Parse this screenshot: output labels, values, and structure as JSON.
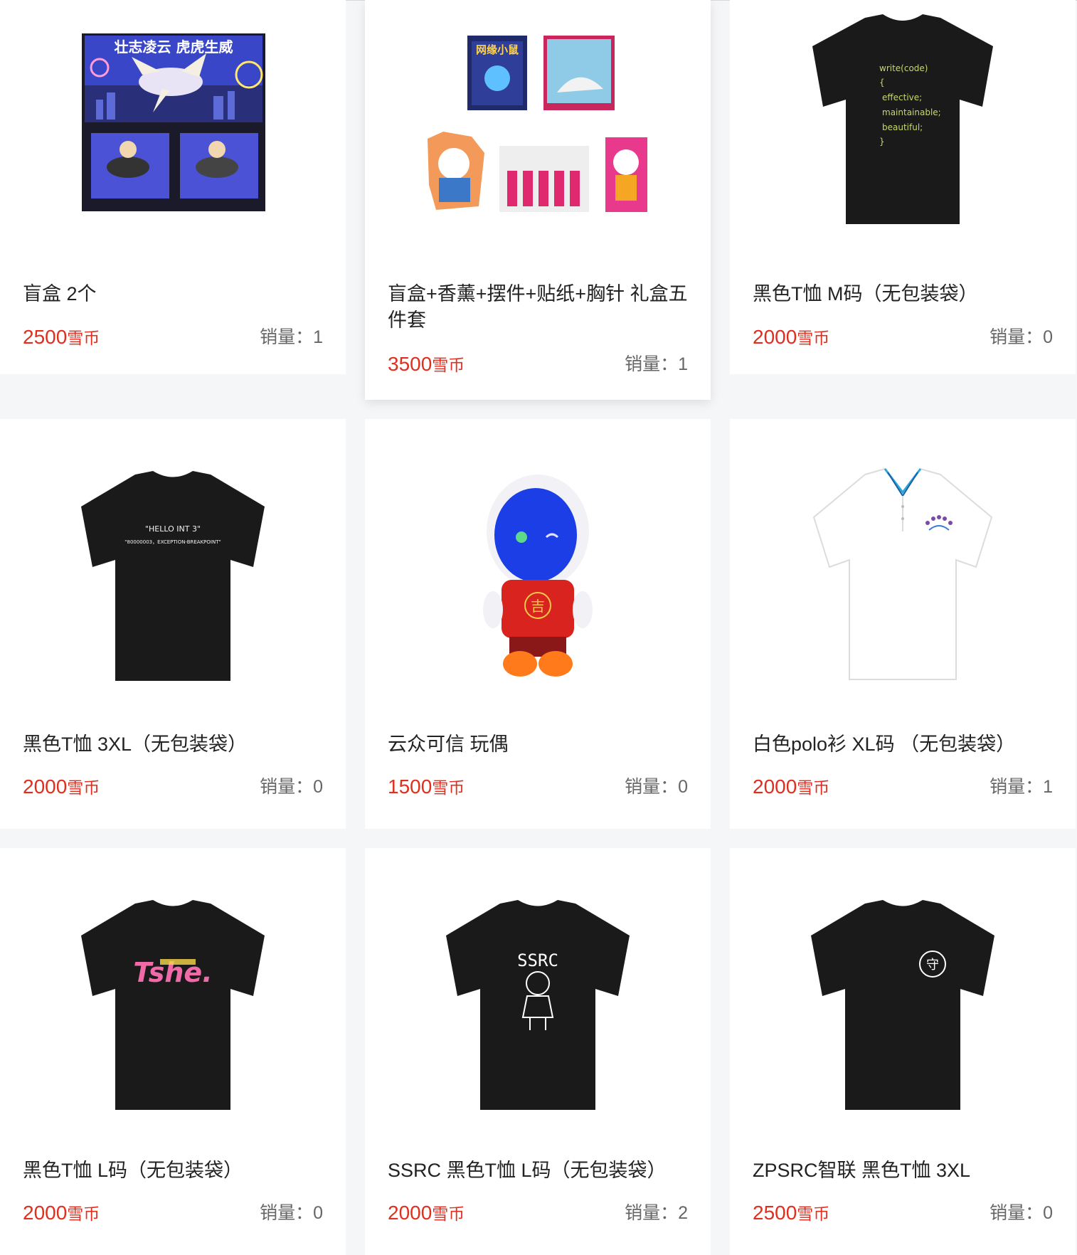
{
  "currency_unit": "雪币",
  "sales_label": "销量：",
  "colors": {
    "price": "#e02e1f",
    "background": "#f5f6f8",
    "card": "#ffffff"
  },
  "products": [
    {
      "name": "盲盒 2个",
      "price": "2500",
      "sales": "1",
      "image_icon": "blind-box-image",
      "image_text": "壮志凌云 虎虎生威"
    },
    {
      "name": "盲盒+香薰+摆件+贴纸+胸针 礼盒五件套",
      "price": "3500",
      "sales": "1",
      "image_icon": "gift-set-image",
      "image_text": "网缘小鼠"
    },
    {
      "name": "黑色T恤 M码（无包装袋）",
      "price": "2000",
      "sales": "0",
      "image_icon": "black-tshirt-code-image",
      "image_lines": [
        "write(code)",
        "{",
        "effective;",
        "maintainable;",
        "beautiful;",
        "}"
      ]
    },
    {
      "name": "黑色T恤 3XL（无包装袋）",
      "price": "2000",
      "sales": "0",
      "image_icon": "black-tshirt-hello-image",
      "image_lines": [
        "\"HELLO  INT  3\"",
        "\"80000003，EXCEPTION-BREAKPOINT\""
      ]
    },
    {
      "name": "云众可信 玩偶",
      "price": "1500",
      "sales": "0",
      "image_icon": "plush-doll-image",
      "image_text": "吉"
    },
    {
      "name": "白色polo衫 XL码 （无包装袋）",
      "price": "2000",
      "sales": "1",
      "image_icon": "white-polo-image"
    },
    {
      "name": "黑色T恤 L码（无包装袋）",
      "price": "2000",
      "sales": "0",
      "image_icon": "black-tshirt-pink-logo-image",
      "image_text": "Tshe."
    },
    {
      "name": "SSRC 黑色T恤 L码（无包装袋）",
      "price": "2000",
      "sales": "2",
      "image_icon": "black-tshirt-ssrc-image",
      "image_text": "SSRC"
    },
    {
      "name": "ZPSRC智联 黑色T恤 3XL",
      "price": "2500",
      "sales": "0",
      "image_icon": "black-tshirt-badge-image",
      "image_text": "守"
    }
  ]
}
